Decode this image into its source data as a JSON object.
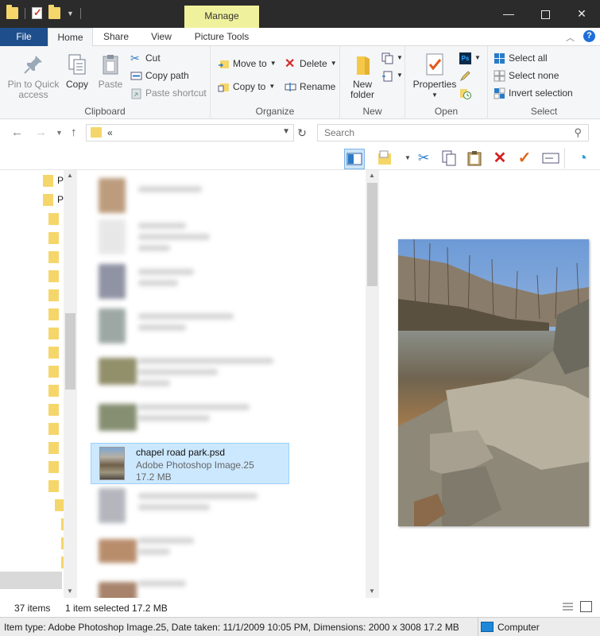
{
  "window": {
    "manage_label": "Manage",
    "minimize": "—",
    "close": "✕"
  },
  "tabs": {
    "file": "File",
    "home": "Home",
    "share": "Share",
    "view": "View",
    "picture_tools": "Picture Tools"
  },
  "ribbon": {
    "clipboard": {
      "label": "Clipboard",
      "pin": "Pin to Quick access",
      "copy": "Copy",
      "paste": "Paste",
      "cut": "Cut",
      "copy_path": "Copy path",
      "paste_shortcut": "Paste shortcut"
    },
    "organize": {
      "label": "Organize",
      "move_to": "Move to",
      "copy_to": "Copy to",
      "delete": "Delete",
      "rename": "Rename"
    },
    "new": {
      "label": "New",
      "new_folder": "New folder"
    },
    "open": {
      "label": "Open",
      "properties": "Properties"
    },
    "select": {
      "label": "Select",
      "select_all": "Select all",
      "select_none": "Select none",
      "invert_selection": "Invert selection"
    }
  },
  "address": {
    "crumb": "«",
    "search_placeholder": "Search"
  },
  "nav_tree": {
    "item1": "P",
    "item2": "P"
  },
  "selected_file": {
    "name": "chapel road park.psd",
    "type": "Adobe Photoshop Image.25",
    "size": "17.2 MB"
  },
  "status": {
    "item_count": "37 items",
    "selection": "1 item selected  17.2 MB"
  },
  "details_bar": {
    "text": "Item type: Adobe Photoshop Image.25, Date taken: 11/1/2009 10:05 PM, Dimensions: 2000 x 3008  17.2 MB",
    "location": "Computer"
  },
  "colors": {
    "titlebar": "#2b2b2b",
    "manage_tab": "#f0f19c",
    "file_tab": "#1e4e8c",
    "selection": "#cce8ff"
  }
}
